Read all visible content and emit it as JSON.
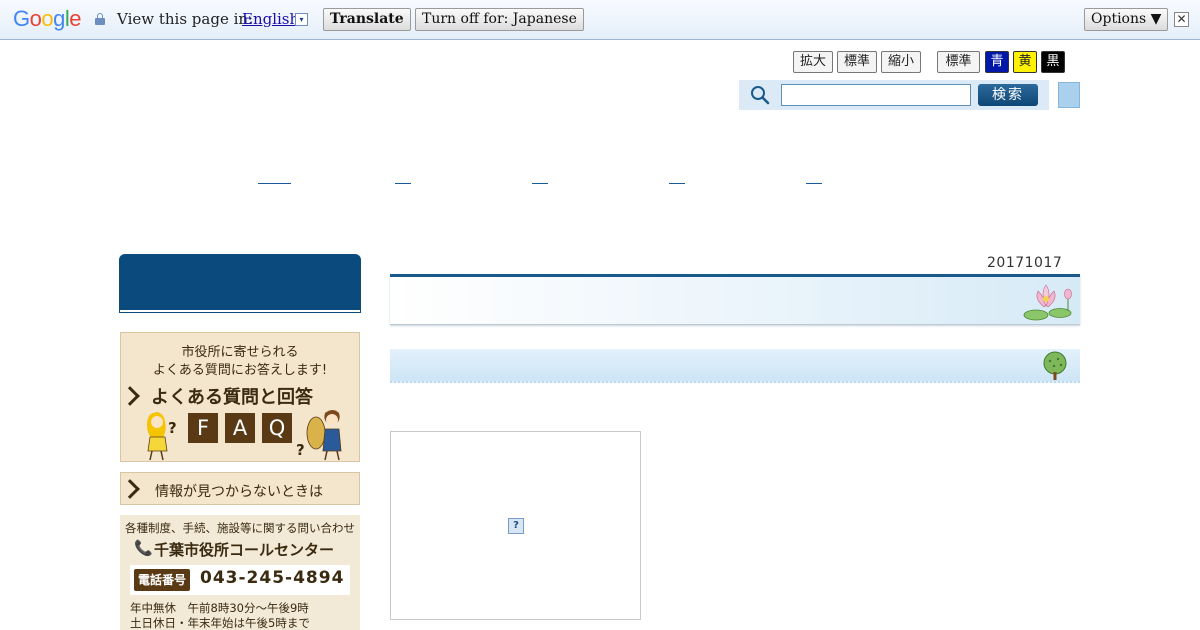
{
  "translate_bar": {
    "logo": {
      "G": "G",
      "o1": "o",
      "o2": "o",
      "g": "g",
      "l": "l",
      "e": "e"
    },
    "prompt": "View this page in:",
    "language": "English",
    "dropdown_glyph": "▾",
    "translate_label": "Translate",
    "turn_off_label": "Turn off for: Japanese",
    "options_label": "Options ▼",
    "close_glyph": "✕"
  },
  "text_size": {
    "enlarge": "拡大",
    "standard": "標準",
    "shrink": "縮小"
  },
  "color_scheme": {
    "standard": "標準",
    "blue": "青",
    "yellow": "黄",
    "black": "黒"
  },
  "search": {
    "button_label": "検索",
    "placeholder": ""
  },
  "main": {
    "date": "20171017"
  },
  "sidebar": {
    "faq": {
      "line1": "市役所に寄せられる",
      "line2": "よくある質問にお答えします!",
      "title": "よくある質問と回答",
      "letters": [
        "F",
        "A",
        "Q"
      ],
      "q1": "?",
      "q2": "?"
    },
    "not_found": "情報が見つからないときは",
    "call_center": {
      "intro": "各種制度、手続、施設等に関する問い合わせ",
      "title": "千葉市役所コールセンター",
      "phone_tag": "電話番号",
      "phone_number": "043-245-4894",
      "hours1": "年中無休　午前8時30分～午後9時",
      "hours2": "土日休日・年末年始は午後5時まで"
    }
  },
  "broken_image_glyph": "?"
}
